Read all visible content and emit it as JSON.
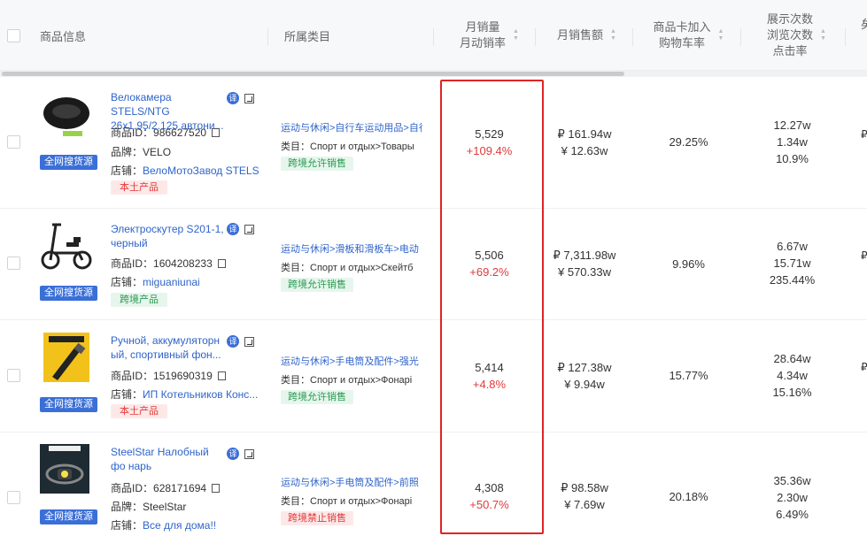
{
  "header": {
    "product_info": "商品信息",
    "category": "所属类目",
    "monthly_sales_l1": "月销量",
    "monthly_sales_l2": "月动销率",
    "monthly_revenue": "月销售额",
    "cart_l1": "商品卡加入",
    "cart_l2": "购物车率",
    "views_l1": "展示次数",
    "views_l2": "浏览次数",
    "views_l3": "点击率",
    "edge_char": "矣"
  },
  "labels": {
    "find_source": "全网搜货源",
    "id": "商品ID：",
    "brand": "品牌：",
    "shop": "店铺：",
    "category_type": "类目：",
    "translate": "译"
  },
  "rows": [
    {
      "title": "Велокамера STELS/NTG 26x1.95/2.125 автони...",
      "id": "986627520",
      "brand": "VELO",
      "shop": "ВелоМотоЗавод STELS",
      "badge": "本土产品",
      "cat_link": "运动与休闲>自行车运动用品>自行",
      "cat_type": "Спорт и отдых>Товары",
      "cat_tag": "跨境允许销售",
      "sales": "5,529",
      "sales_growth": "+109.4%",
      "rev_rub": "₽ 161.94w",
      "rev_cny": "¥ 12.63w",
      "cart_rate": "29.25%",
      "views": "12.27w",
      "browse": "1.34w",
      "ctr": "10.9%",
      "edge": "₽"
    },
    {
      "title": "Электроскутер S201-1, черный",
      "id": "1604208233",
      "shop": "miguaniunai",
      "badge": "跨境产品",
      "cat_link": "运动与休闲>滑板和滑板车>电动",
      "cat_type": "Спорт и отдых>Скейтб",
      "cat_tag": "跨境允许销售",
      "sales": "5,506",
      "sales_growth": "+69.2%",
      "rev_rub": "₽ 7,311.98w",
      "rev_cny": "¥ 570.33w",
      "cart_rate": "9.96%",
      "views": "6.67w",
      "browse": "15.71w",
      "ctr": "235.44%",
      "edge": "₽"
    },
    {
      "title": "Ручной, аккумуляторн ый, спортивный фон...",
      "id": "1519690319",
      "shop": "ИП Котельников Конс...",
      "badge": "本土产品",
      "cat_link": "运动与休闲>手电筒及配件>强光",
      "cat_type": "Спорт и отдых>Фонарі",
      "cat_tag": "跨境允许销售",
      "sales": "5,414",
      "sales_growth": "+4.8%",
      "rev_rub": "₽ 127.38w",
      "rev_cny": "¥ 9.94w",
      "cart_rate": "15.77%",
      "views": "28.64w",
      "browse": "4.34w",
      "ctr": "15.16%",
      "edge": "₽"
    },
    {
      "title": "SteelStar Налобный фо нарь",
      "id": "628171694",
      "brand": "SteelStar",
      "shop": "Все для дома!!",
      "cat_link": "运动与休闲>手电筒及配件>前照",
      "cat_type": "Спорт и отдых>Фонарі",
      "cat_tag": "跨境禁止销售",
      "sales": "4,308",
      "sales_growth": "+50.7%",
      "rev_rub": "₽ 98.58w",
      "rev_cny": "¥ 7.69w",
      "cart_rate": "20.18%",
      "views": "35.36w",
      "browse": "2.30w",
      "ctr": "6.49%",
      "edge": "₽"
    }
  ]
}
